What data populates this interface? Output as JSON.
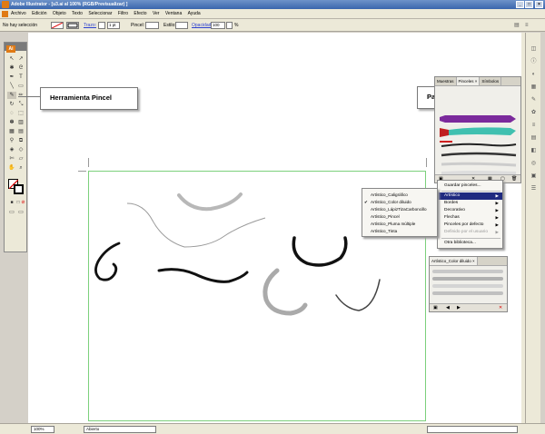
{
  "window": {
    "title": "Adobe Illustrator - [u3.ai al 100% (RGB/Previsualizar) ]",
    "controls": [
      "_",
      "□",
      "×"
    ]
  },
  "menubar": {
    "items": [
      "Archivo",
      "Edición",
      "Objeto",
      "Texto",
      "Seleccionar",
      "Filtro",
      "Efecto",
      "Ver",
      "Ventana",
      "Ayuda"
    ]
  },
  "control_bar": {
    "selection": "No hay selección",
    "stroke_label": "Trazo:",
    "stroke_value": "1 pt",
    "brush_label": "Pincel:",
    "style_label": "Estilo:",
    "opacity_label": "Opacidad:",
    "opacity_value": "100",
    "opacity_unit": "%"
  },
  "toolbox": {
    "logo": "Ai"
  },
  "callouts": {
    "pincel": "Herramienta Pincel",
    "paleta": "Paleta de pinceles"
  },
  "brush_panel": {
    "tabs": [
      "Muestras",
      "Pinceles ×",
      "Símbolos"
    ],
    "active_tab": "Pinceles ×"
  },
  "panel_menu": {
    "items": [
      {
        "label": "Guardar pinceles...",
        "submenu": false,
        "selected": false,
        "disabled": false
      },
      {
        "label": "Artístico",
        "submenu": true,
        "selected": true,
        "disabled": false
      },
      {
        "label": "Bordes",
        "submenu": true,
        "selected": false,
        "disabled": false
      },
      {
        "label": "Decorativo",
        "submenu": true,
        "selected": false,
        "disabled": false
      },
      {
        "label": "Flechas",
        "submenu": true,
        "selected": false,
        "disabled": false
      },
      {
        "label": "Pinceles por defecto",
        "submenu": true,
        "selected": false,
        "disabled": false
      },
      {
        "label": "Definido por el usuario",
        "submenu": true,
        "selected": false,
        "disabled": true
      },
      {
        "label": "Otra biblioteca...",
        "submenu": false,
        "selected": false,
        "disabled": false
      }
    ]
  },
  "submenu": {
    "items": [
      {
        "label": "Artístico_Caligráfico",
        "checked": false
      },
      {
        "label": "Artístico_Color diluido",
        "checked": true
      },
      {
        "label": "Artístico_LápizTizaCarboncillo",
        "checked": false
      },
      {
        "label": "Artístico_Pincel",
        "checked": false
      },
      {
        "label": "Artístico_Pluma múltiple",
        "checked": false
      },
      {
        "label": "Artístico_Tinta",
        "checked": false
      }
    ]
  },
  "library_panel": {
    "tab": "Artístico_Color diluido ×"
  },
  "statusbar": {
    "zoom": "100%",
    "status": "Abierto"
  },
  "colors": {
    "title_bar": "#3a66ad",
    "artboard_border": "#7cd07c",
    "menu_highlight": "#1f2a80",
    "ai_orange": "#e07a14"
  }
}
